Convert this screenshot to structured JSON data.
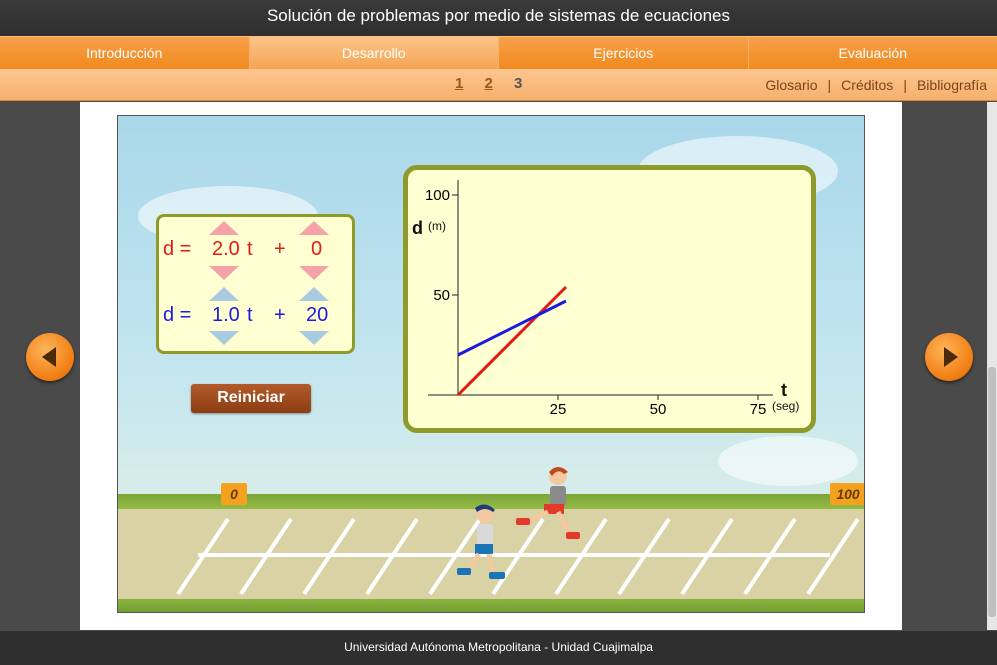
{
  "title": "Solución de problemas por medio de sistemas de ecuaciones",
  "nav": {
    "items": [
      "Introducción",
      "Desarrollo",
      "Ejercicios",
      "Evaluación"
    ],
    "active": "Desarrollo"
  },
  "pages": {
    "p1": "1",
    "p2": "2",
    "p3": "3"
  },
  "links": {
    "glosario": "Glosario",
    "creditos": "Créditos",
    "bibliografia": "Bibliografía",
    "separator": "|"
  },
  "equations": {
    "red": {
      "lhs": "d =",
      "coef": "2.0",
      "var": "t",
      "plus": "+",
      "const": "0",
      "color": "#e21a1a"
    },
    "blue": {
      "lhs": "d =",
      "coef": "1.0",
      "var": "t",
      "plus": "+",
      "const": "20",
      "color": "#1a1ae2"
    }
  },
  "reset_label": "Reiniciar",
  "graph": {
    "y_label": "d",
    "y_unit": "(m)",
    "x_label": "t",
    "x_unit": "(seg)",
    "y_ticks": [
      "100",
      "50"
    ],
    "x_ticks": [
      "25",
      "50",
      "75"
    ]
  },
  "chart_data": {
    "type": "line",
    "xlabel": "t",
    "ylabel": "d",
    "xlim": [
      0,
      75
    ],
    "ylim": [
      0,
      100
    ],
    "series": [
      {
        "x": [
          0,
          27
        ],
        "y": [
          0,
          54
        ],
        "color": "#e21a1a"
      },
      {
        "x": [
          0,
          27
        ],
        "y": [
          20,
          47
        ],
        "color": "#1a1ae2"
      }
    ]
  },
  "track": {
    "start_marker": "0",
    "end_marker": "100"
  },
  "footer": "Universidad Autónoma Metropolitana - Unidad Cuajimalpa"
}
